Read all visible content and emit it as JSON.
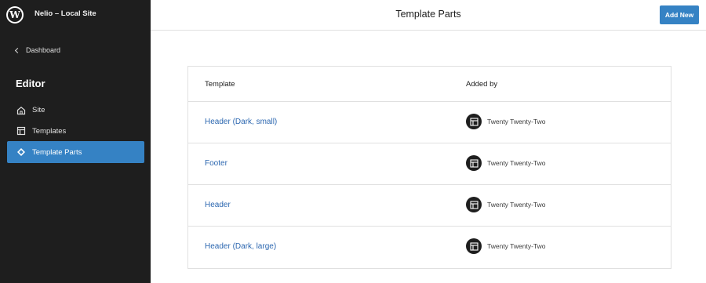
{
  "sidebar": {
    "site_title": "Nelio – Local Site",
    "back_label": "Dashboard",
    "editor_title": "Editor",
    "items": [
      {
        "label": "Site",
        "icon": "home-icon"
      },
      {
        "label": "Templates",
        "icon": "layout-icon"
      },
      {
        "label": "Template Parts",
        "icon": "symbol-icon",
        "active": true
      }
    ]
  },
  "header": {
    "title": "Template Parts",
    "add_new_label": "Add New"
  },
  "table": {
    "columns": [
      "Template",
      "Added by"
    ],
    "rows": [
      {
        "name": "Header (Dark, small)",
        "added_by": "Twenty Twenty-Two"
      },
      {
        "name": "Footer",
        "added_by": "Twenty Twenty-Two"
      },
      {
        "name": "Header",
        "added_by": "Twenty Twenty-Two"
      },
      {
        "name": "Header (Dark, large)",
        "added_by": "Twenty Twenty-Two"
      }
    ]
  },
  "colors": {
    "sidebar_bg": "#1e1e1e",
    "accent": "#3582c4",
    "link": "#2c67b0"
  }
}
